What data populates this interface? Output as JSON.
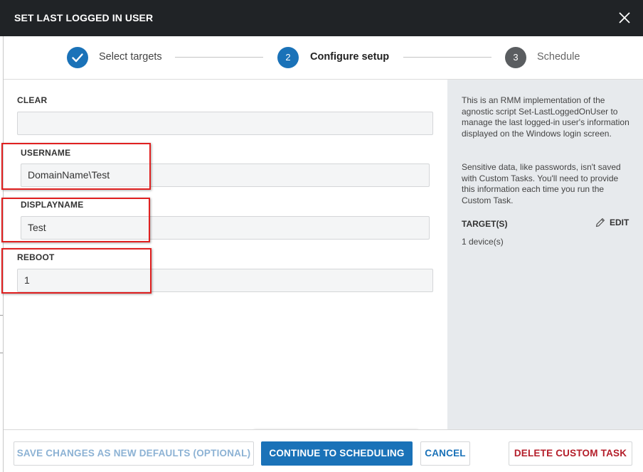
{
  "dialog": {
    "title": "SET LAST LOGGED IN USER"
  },
  "colors": {
    "accent": "#1a72b8",
    "inactive_step": "#5a5d60",
    "danger": "#b41e2a",
    "highlight": "#e02020"
  },
  "stepper": {
    "steps": [
      {
        "number": "",
        "label": "Select targets",
        "state": "complete"
      },
      {
        "number": "2",
        "label": "Configure setup",
        "state": "active"
      },
      {
        "number": "3",
        "label": "Schedule",
        "state": "pending"
      }
    ]
  },
  "form": {
    "fields": [
      {
        "label": "CLEAR",
        "value": ""
      },
      {
        "label": "USERNAME",
        "value": "DomainName\\Test"
      },
      {
        "label": "DISPLAYNAME",
        "value": "Test"
      },
      {
        "label": "REBOOT",
        "value": "1"
      }
    ]
  },
  "side_panel": {
    "description": "This is an RMM implementation of the agnostic script Set-LastLoggedOnUser to manage the last logged-in user's information displayed on the Windows login screen.",
    "sensitive_note": "Sensitive data, like passwords, isn't saved with Custom Tasks. You'll need to provide this information each time you run the Custom Task.",
    "targets_label": "TARGET(S)",
    "edit_label": "EDIT",
    "devices_text": "1 device(s)"
  },
  "footer": {
    "save_label": "SAVE CHANGES AS NEW DEFAULTS (OPTIONAL)",
    "continue_label": "CONTINUE TO SCHEDULING",
    "cancel_label": "CANCEL",
    "delete_label": "DELETE CUSTOM TASK"
  }
}
